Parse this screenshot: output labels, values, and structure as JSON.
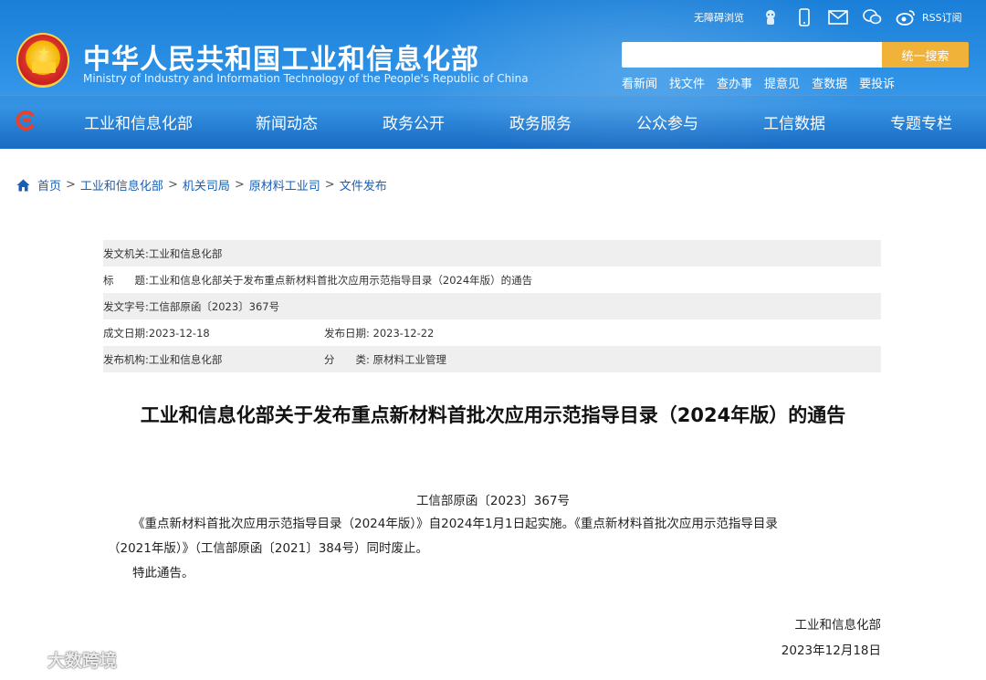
{
  "header": {
    "title_cn": "中华人民共和国工业和信息化部",
    "title_en": "Ministry of Industry and Information Technology of the People's Republic of China",
    "accessible_label": "无障碍浏览",
    "rss_label": "RSS订阅",
    "search_placeholder": "",
    "search_button": "统一搜索",
    "quick_links": [
      "看新闻",
      "找文件",
      "查办事",
      "提意见",
      "查数据",
      "要投诉"
    ]
  },
  "nav": {
    "items": [
      "工业和信息化部",
      "新闻动态",
      "政务公开",
      "政务服务",
      "公众参与",
      "工信数据",
      "专题专栏"
    ]
  },
  "breadcrumb": [
    "首页",
    "工业和信息化部",
    "机关司局",
    "原材料工业司",
    "文件发布"
  ],
  "meta": {
    "issuer_label": "发文机关:",
    "issuer": "工业和信息化部",
    "title_label": "标　　题:",
    "title": "工业和信息化部关于发布重点新材料首批次应用示范指导目录（2024年版）的通告",
    "doc_no_label": "发文字号:",
    "doc_no": "工信部原函〔2023〕367号",
    "created_label": "成文日期:",
    "created": "2023-12-18",
    "published_label": "发布日期:",
    "published": "2023-12-22",
    "agency_label": "发布机构:",
    "agency": "工业和信息化部",
    "category_label": "分　　类:",
    "category": "原材料工业管理"
  },
  "article": {
    "title": "工业和信息化部关于发布重点新材料首批次应用示范指导目录（2024年版）的通告",
    "doc_number": "工信部原函〔2023〕367号",
    "para1_line1": "《重点新材料首批次应用示范指导目录（2024年版）》自2024年1月1日起实施。《重点新材料首批次应用示范指导目录",
    "para1_line2": "（2021年版）》（工信部原函〔2021〕384号）同时废止。",
    "para2": "特此通告。",
    "sign_org": "工业和信息化部",
    "sign_date": "2023年12月18日"
  },
  "watermark": {
    "text": "大数跨境"
  },
  "colors": {
    "header_blue": "#2b8fe4",
    "search_button": "#f1b23a",
    "link_blue": "#1a5fb4",
    "meta_shade": "#efefef"
  }
}
